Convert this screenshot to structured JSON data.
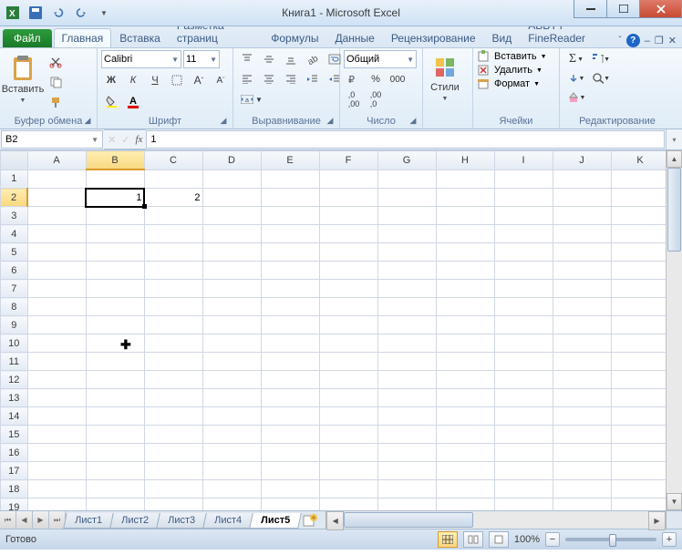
{
  "title": "Книга1 - Microsoft Excel",
  "tabs": {
    "file": "Файл",
    "home": "Главная",
    "insert": "Вставка",
    "layout": "Разметка страниц",
    "formulas": "Формулы",
    "data": "Данные",
    "review": "Рецензирование",
    "view": "Вид",
    "abbyy": "ABBYY FineReader"
  },
  "ribbon": {
    "clipboard": {
      "label": "Буфер обмена",
      "paste": "Вставить"
    },
    "font": {
      "label": "Шрифт",
      "name": "Calibri",
      "size": "11",
      "bold": "Ж",
      "italic": "К",
      "underline": "Ч"
    },
    "align": {
      "label": "Выравнивание"
    },
    "number": {
      "label": "Число",
      "format": "Общий"
    },
    "styles": {
      "label": "Стили",
      "btn": "Стили"
    },
    "cells": {
      "label": "Ячейки",
      "insert": "Вставить",
      "delete": "Удалить",
      "format": "Формат"
    },
    "editing": {
      "label": "Редактирование"
    }
  },
  "namebox": "B2",
  "formula": "1",
  "columns": [
    "A",
    "B",
    "C",
    "D",
    "E",
    "F",
    "G",
    "H",
    "I",
    "J",
    "K"
  ],
  "rows": [
    "1",
    "2",
    "3",
    "4",
    "5",
    "6",
    "7",
    "8",
    "9",
    "10",
    "11",
    "12",
    "13",
    "14",
    "15",
    "16",
    "17",
    "18",
    "19"
  ],
  "cells": {
    "B2": "1",
    "C2": "2"
  },
  "active_cell": "B2",
  "sheets": [
    "Лист1",
    "Лист2",
    "Лист3",
    "Лист4",
    "Лист5"
  ],
  "active_sheet": "Лист5",
  "status": {
    "ready": "Готово",
    "zoom": "100%"
  }
}
